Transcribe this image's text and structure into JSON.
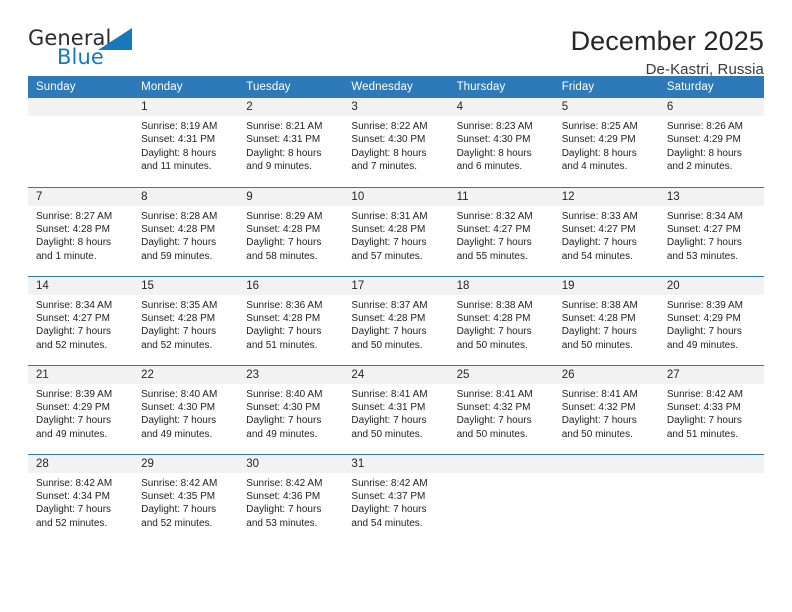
{
  "logo": {
    "word_one": "General",
    "word_two": "Blue",
    "flag_icon": "triangle-flag-icon",
    "brand_color": "#1878bd"
  },
  "header": {
    "title": "December 2025",
    "subtitle": "De-Kastri, Russia"
  },
  "calendar": {
    "header_color": "#2e7ab8",
    "daynum_band_color": "#f2f2f2",
    "weekdays": [
      "Sunday",
      "Monday",
      "Tuesday",
      "Wednesday",
      "Thursday",
      "Friday",
      "Saturday"
    ],
    "labels": {
      "sunrise": "Sunrise:",
      "sunset": "Sunset:",
      "daylight": "Daylight:"
    },
    "weeks": [
      [
        {
          "day": "",
          "empty": true
        },
        {
          "day": "1",
          "sunrise": "Sunrise: 8:19 AM",
          "sunset": "Sunset: 4:31 PM",
          "daylight_line1": "Daylight: 8 hours",
          "daylight_line2": "and 11 minutes."
        },
        {
          "day": "2",
          "sunrise": "Sunrise: 8:21 AM",
          "sunset": "Sunset: 4:31 PM",
          "daylight_line1": "Daylight: 8 hours",
          "daylight_line2": "and 9 minutes."
        },
        {
          "day": "3",
          "sunrise": "Sunrise: 8:22 AM",
          "sunset": "Sunset: 4:30 PM",
          "daylight_line1": "Daylight: 8 hours",
          "daylight_line2": "and 7 minutes."
        },
        {
          "day": "4",
          "sunrise": "Sunrise: 8:23 AM",
          "sunset": "Sunset: 4:30 PM",
          "daylight_line1": "Daylight: 8 hours",
          "daylight_line2": "and 6 minutes."
        },
        {
          "day": "5",
          "sunrise": "Sunrise: 8:25 AM",
          "sunset": "Sunset: 4:29 PM",
          "daylight_line1": "Daylight: 8 hours",
          "daylight_line2": "and 4 minutes."
        },
        {
          "day": "6",
          "sunrise": "Sunrise: 8:26 AM",
          "sunset": "Sunset: 4:29 PM",
          "daylight_line1": "Daylight: 8 hours",
          "daylight_line2": "and 2 minutes."
        }
      ],
      [
        {
          "day": "7",
          "sunrise": "Sunrise: 8:27 AM",
          "sunset": "Sunset: 4:28 PM",
          "daylight_line1": "Daylight: 8 hours",
          "daylight_line2": "and 1 minute."
        },
        {
          "day": "8",
          "sunrise": "Sunrise: 8:28 AM",
          "sunset": "Sunset: 4:28 PM",
          "daylight_line1": "Daylight: 7 hours",
          "daylight_line2": "and 59 minutes."
        },
        {
          "day": "9",
          "sunrise": "Sunrise: 8:29 AM",
          "sunset": "Sunset: 4:28 PM",
          "daylight_line1": "Daylight: 7 hours",
          "daylight_line2": "and 58 minutes."
        },
        {
          "day": "10",
          "sunrise": "Sunrise: 8:31 AM",
          "sunset": "Sunset: 4:28 PM",
          "daylight_line1": "Daylight: 7 hours",
          "daylight_line2": "and 57 minutes."
        },
        {
          "day": "11",
          "sunrise": "Sunrise: 8:32 AM",
          "sunset": "Sunset: 4:27 PM",
          "daylight_line1": "Daylight: 7 hours",
          "daylight_line2": "and 55 minutes."
        },
        {
          "day": "12",
          "sunrise": "Sunrise: 8:33 AM",
          "sunset": "Sunset: 4:27 PM",
          "daylight_line1": "Daylight: 7 hours",
          "daylight_line2": "and 54 minutes."
        },
        {
          "day": "13",
          "sunrise": "Sunrise: 8:34 AM",
          "sunset": "Sunset: 4:27 PM",
          "daylight_line1": "Daylight: 7 hours",
          "daylight_line2": "and 53 minutes."
        }
      ],
      [
        {
          "day": "14",
          "sunrise": "Sunrise: 8:34 AM",
          "sunset": "Sunset: 4:27 PM",
          "daylight_line1": "Daylight: 7 hours",
          "daylight_line2": "and 52 minutes."
        },
        {
          "day": "15",
          "sunrise": "Sunrise: 8:35 AM",
          "sunset": "Sunset: 4:28 PM",
          "daylight_line1": "Daylight: 7 hours",
          "daylight_line2": "and 52 minutes."
        },
        {
          "day": "16",
          "sunrise": "Sunrise: 8:36 AM",
          "sunset": "Sunset: 4:28 PM",
          "daylight_line1": "Daylight: 7 hours",
          "daylight_line2": "and 51 minutes."
        },
        {
          "day": "17",
          "sunrise": "Sunrise: 8:37 AM",
          "sunset": "Sunset: 4:28 PM",
          "daylight_line1": "Daylight: 7 hours",
          "daylight_line2": "and 50 minutes."
        },
        {
          "day": "18",
          "sunrise": "Sunrise: 8:38 AM",
          "sunset": "Sunset: 4:28 PM",
          "daylight_line1": "Daylight: 7 hours",
          "daylight_line2": "and 50 minutes."
        },
        {
          "day": "19",
          "sunrise": "Sunrise: 8:38 AM",
          "sunset": "Sunset: 4:28 PM",
          "daylight_line1": "Daylight: 7 hours",
          "daylight_line2": "and 50 minutes."
        },
        {
          "day": "20",
          "sunrise": "Sunrise: 8:39 AM",
          "sunset": "Sunset: 4:29 PM",
          "daylight_line1": "Daylight: 7 hours",
          "daylight_line2": "and 49 minutes."
        }
      ],
      [
        {
          "day": "21",
          "sunrise": "Sunrise: 8:39 AM",
          "sunset": "Sunset: 4:29 PM",
          "daylight_line1": "Daylight: 7 hours",
          "daylight_line2": "and 49 minutes."
        },
        {
          "day": "22",
          "sunrise": "Sunrise: 8:40 AM",
          "sunset": "Sunset: 4:30 PM",
          "daylight_line1": "Daylight: 7 hours",
          "daylight_line2": "and 49 minutes."
        },
        {
          "day": "23",
          "sunrise": "Sunrise: 8:40 AM",
          "sunset": "Sunset: 4:30 PM",
          "daylight_line1": "Daylight: 7 hours",
          "daylight_line2": "and 49 minutes."
        },
        {
          "day": "24",
          "sunrise": "Sunrise: 8:41 AM",
          "sunset": "Sunset: 4:31 PM",
          "daylight_line1": "Daylight: 7 hours",
          "daylight_line2": "and 50 minutes."
        },
        {
          "day": "25",
          "sunrise": "Sunrise: 8:41 AM",
          "sunset": "Sunset: 4:32 PM",
          "daylight_line1": "Daylight: 7 hours",
          "daylight_line2": "and 50 minutes."
        },
        {
          "day": "26",
          "sunrise": "Sunrise: 8:41 AM",
          "sunset": "Sunset: 4:32 PM",
          "daylight_line1": "Daylight: 7 hours",
          "daylight_line2": "and 50 minutes."
        },
        {
          "day": "27",
          "sunrise": "Sunrise: 8:42 AM",
          "sunset": "Sunset: 4:33 PM",
          "daylight_line1": "Daylight: 7 hours",
          "daylight_line2": "and 51 minutes."
        }
      ],
      [
        {
          "day": "28",
          "sunrise": "Sunrise: 8:42 AM",
          "sunset": "Sunset: 4:34 PM",
          "daylight_line1": "Daylight: 7 hours",
          "daylight_line2": "and 52 minutes."
        },
        {
          "day": "29",
          "sunrise": "Sunrise: 8:42 AM",
          "sunset": "Sunset: 4:35 PM",
          "daylight_line1": "Daylight: 7 hours",
          "daylight_line2": "and 52 minutes."
        },
        {
          "day": "30",
          "sunrise": "Sunrise: 8:42 AM",
          "sunset": "Sunset: 4:36 PM",
          "daylight_line1": "Daylight: 7 hours",
          "daylight_line2": "and 53 minutes."
        },
        {
          "day": "31",
          "sunrise": "Sunrise: 8:42 AM",
          "sunset": "Sunset: 4:37 PM",
          "daylight_line1": "Daylight: 7 hours",
          "daylight_line2": "and 54 minutes."
        },
        {
          "day": "",
          "empty": true
        },
        {
          "day": "",
          "empty": true
        },
        {
          "day": "",
          "empty": true
        }
      ]
    ]
  }
}
